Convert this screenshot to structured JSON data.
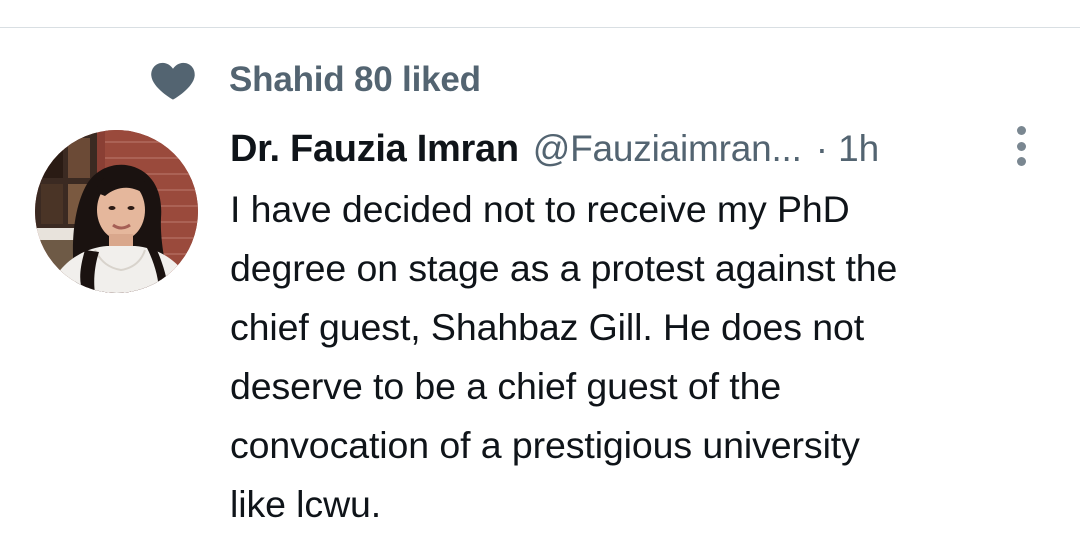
{
  "social_context": {
    "text": "Shahid 80 liked",
    "icon": "heart-icon"
  },
  "tweet": {
    "author": {
      "display_name": "Dr. Fauzia Imran",
      "handle": "@Fauziaimran...",
      "avatar": "avatar"
    },
    "separator": "·",
    "timestamp": "1h",
    "more_icon": "more-vertical-icon",
    "text_lines": [
      "I have decided not to receive my PhD",
      "degree on stage as a protest against the",
      "chief guest, Shahbaz Gill. He does not",
      "deserve to be a chief guest of the",
      "convocation of a prestigious university",
      "like lcwu."
    ]
  },
  "colors": {
    "text_primary": "#0f1419",
    "text_secondary": "#536471",
    "divider": "#d9dfe3",
    "background": "#ffffff"
  }
}
